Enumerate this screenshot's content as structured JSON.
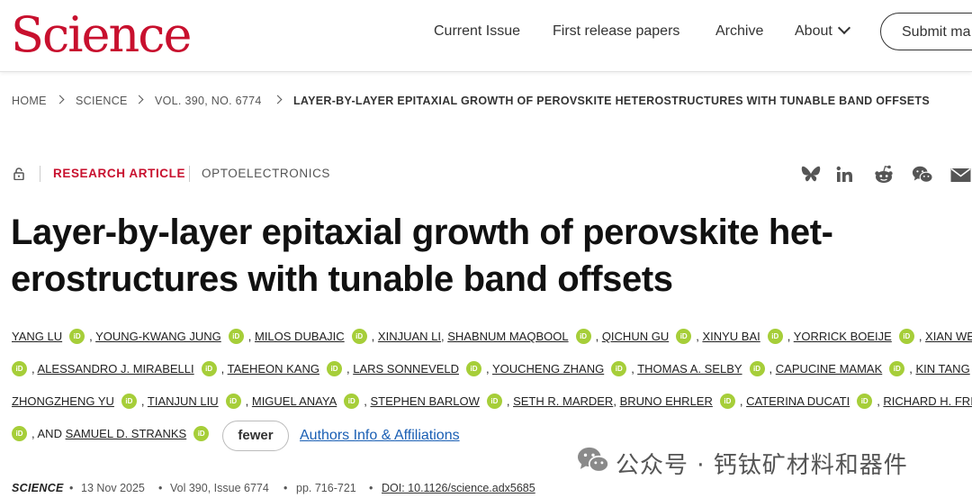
{
  "header": {
    "logo": "Science",
    "nav": [
      "Current Issue",
      "First release papers",
      "Archive",
      "About"
    ],
    "submit_label": "Submit ma"
  },
  "breadcrumb": [
    "HOME",
    "SCIENCE",
    "VOL. 390, NO. 6774",
    "LAYER-BY-LAYER EPITAXIAL GROWTH OF PEROVSKITE HETEROSTRUCTURES WITH TUNABLE BAND OFFSETS"
  ],
  "article": {
    "type": "RESEARCH ARTICLE",
    "subject": "OPTOELECTRONICS",
    "title_line1": "Layer-by-layer epitaxial growth of perovskite het-",
    "title_line2": "erostructures with tunable band offsets"
  },
  "share_icons": [
    "bluesky-icon",
    "linkedin-icon",
    "reddit-icon",
    "wechat-icon",
    "email-icon"
  ],
  "authors": {
    "row1": [
      "YANG LU",
      "YOUNG-KWANG JUNG",
      "MILOS DUBAJIC",
      "XINJUAN LI",
      "SHABNUM MAQBOOL",
      "QICHUN GU",
      "XINYU BAI",
      "YORRICK BOEIJE",
      "XIAN WEI CHUA"
    ],
    "row2": [
      "ALESSANDRO J. MIRABELLI",
      "TAEHEON KANG",
      "LARS SONNEVELD",
      "YOUCHENG ZHANG",
      "THOMAS A. SELBY",
      "CAPUCINE MAMAK",
      "KIN TANG"
    ],
    "row3": [
      "ZHONGZHENG YU",
      "TIANJUN LIU",
      "MIGUEL ANAYA",
      "STEPHEN BARLOW",
      "SETH R. MARDER",
      "BRUNO EHRLER",
      "CATERINA DUCATI",
      "RICHARD H. FRIEND"
    ],
    "and_label": ", AND",
    "last": "SAMUEL D. STRANKS",
    "orcid_label": "iD",
    "fewer_label": "fewer",
    "affiliations_label": "Authors Info & Affiliations"
  },
  "watermark": "公众号 · 钙钛矿材料和器件",
  "citation": {
    "journal": "SCIENCE",
    "date": "13 Nov 2025",
    "issue": "Vol 390, Issue 6774",
    "pages": "pp. 716-721",
    "doi": "DOI: 10.1126/science.adx5685",
    "bullet": "•"
  },
  "colors": {
    "brand": "#c8102e",
    "orcid": "#a6ce39",
    "link": "#1a5fb4"
  }
}
